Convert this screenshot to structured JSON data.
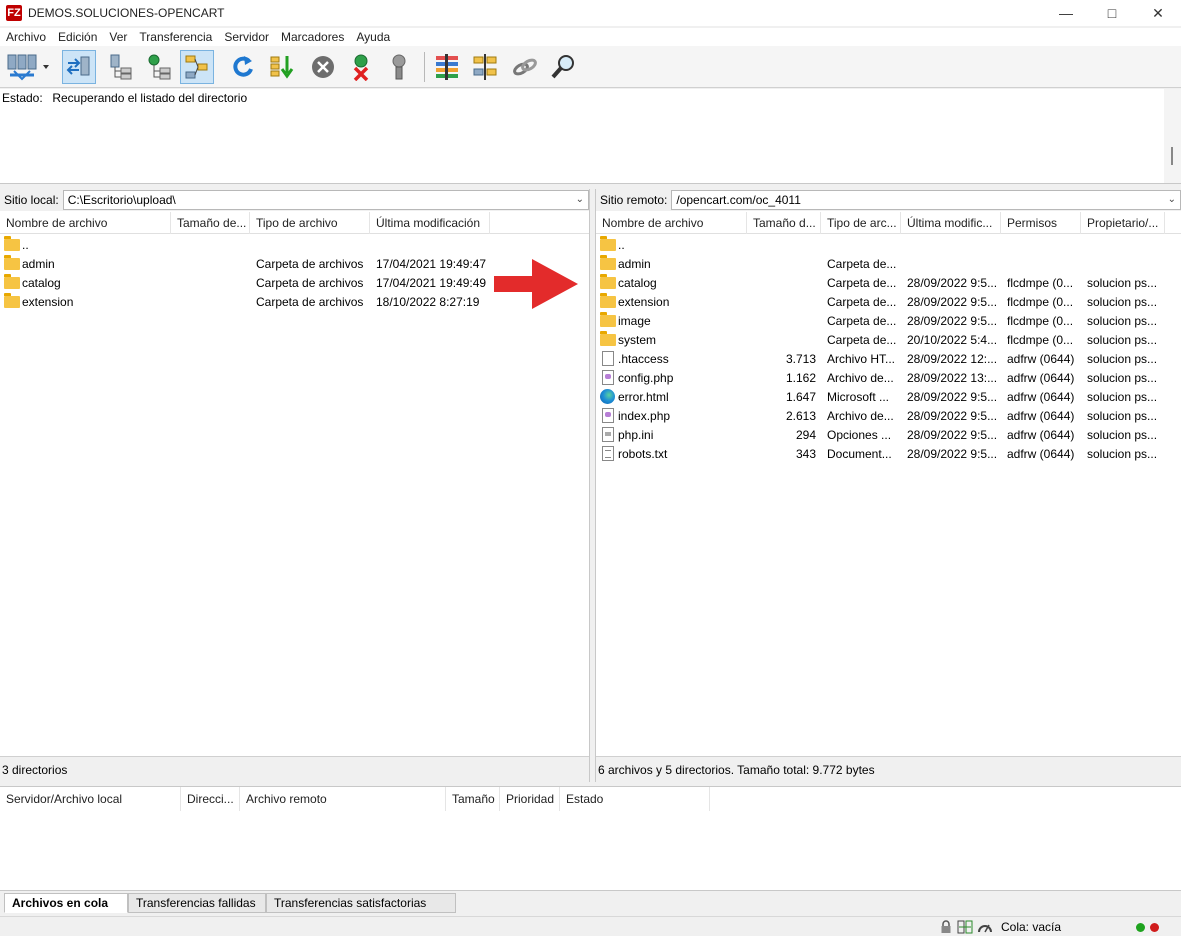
{
  "window": {
    "title": "DEMOS.SOLUCIONES-OPENCART",
    "app_icon": "FZ",
    "controls": [
      "minimize-icon",
      "maximize-icon",
      "close-icon"
    ]
  },
  "menu": [
    "Archivo",
    "Edición",
    "Ver",
    "Transferencia",
    "Servidor",
    "Marcadores",
    "Ayuda"
  ],
  "toolbar": {
    "buttons": [
      "site-manager-icon",
      "toggle-message-log-icon",
      "toggle-local-tree-icon",
      "toggle-remote-tree-icon",
      "toggle-queue-icon",
      "refresh-icon",
      "process-queue-icon",
      "cancel-icon",
      "disconnect-icon",
      "reconnect-icon",
      "directory-comparison-icon",
      "filter-icon",
      "sync-browsing-icon",
      "search-icon"
    ]
  },
  "message_log": {
    "label": "Estado:",
    "text": "Recuperando el listado del directorio"
  },
  "local": {
    "site_label": "Sitio local:",
    "path": "C:\\Escritorio\\upload\\",
    "columns": [
      "Nombre de archivo",
      "Tamaño de...",
      "Tipo de archivo",
      "Última modificación"
    ],
    "rows": [
      {
        "name": "..",
        "size": "",
        "type": "",
        "modified": "",
        "icon": "folder"
      },
      {
        "name": "admin",
        "size": "",
        "type": "Carpeta de archivos",
        "modified": "17/04/2021 19:49:47",
        "icon": "folder"
      },
      {
        "name": "catalog",
        "size": "",
        "type": "Carpeta de archivos",
        "modified": "17/04/2021 19:49:49",
        "icon": "folder"
      },
      {
        "name": "extension",
        "size": "",
        "type": "Carpeta de archivos",
        "modified": "18/10/2022 8:27:19",
        "icon": "folder"
      }
    ],
    "status": "3 directorios"
  },
  "remote": {
    "site_label": "Sitio remoto:",
    "path": "/opencart.com/oc_4011",
    "columns": [
      "Nombre de archivo",
      "Tamaño d...",
      "Tipo de arc...",
      "Última modific...",
      "Permisos",
      "Propietario/..."
    ],
    "rows": [
      {
        "name": "..",
        "size": "",
        "type": "",
        "modified": "",
        "perms": "",
        "owner": "",
        "icon": "folder"
      },
      {
        "name": "admin",
        "size": "",
        "type": "Carpeta de...",
        "modified": "",
        "perms": "",
        "owner": "",
        "icon": "folder"
      },
      {
        "name": "catalog",
        "size": "",
        "type": "Carpeta de...",
        "modified": "28/09/2022 9:5...",
        "perms": "flcdmpe (0...",
        "owner": "solucion ps...",
        "icon": "folder"
      },
      {
        "name": "extension",
        "size": "",
        "type": "Carpeta de...",
        "modified": "28/09/2022 9:5...",
        "perms": "flcdmpe (0...",
        "owner": "solucion ps...",
        "icon": "folder"
      },
      {
        "name": "image",
        "size": "",
        "type": "Carpeta de...",
        "modified": "28/09/2022 9:5...",
        "perms": "flcdmpe (0...",
        "owner": "solucion ps...",
        "icon": "folder"
      },
      {
        "name": "system",
        "size": "",
        "type": "Carpeta de...",
        "modified": "20/10/2022 5:4...",
        "perms": "flcdmpe (0...",
        "owner": "solucion ps...",
        "icon": "folder"
      },
      {
        "name": ".htaccess",
        "size": "3.713",
        "type": "Archivo HT...",
        "modified": "28/09/2022 12:...",
        "perms": "adfrw (0644)",
        "owner": "solucion ps...",
        "icon": "file"
      },
      {
        "name": "config.php",
        "size": "1.162",
        "type": "Archivo de...",
        "modified": "28/09/2022 13:...",
        "perms": "adfrw (0644)",
        "owner": "solucion ps...",
        "icon": "php"
      },
      {
        "name": "error.html",
        "size": "1.647",
        "type": "Microsoft ...",
        "modified": "28/09/2022 9:5...",
        "perms": "adfrw (0644)",
        "owner": "solucion ps...",
        "icon": "edge"
      },
      {
        "name": "index.php",
        "size": "2.613",
        "type": "Archivo de...",
        "modified": "28/09/2022 9:5...",
        "perms": "adfrw (0644)",
        "owner": "solucion ps...",
        "icon": "php"
      },
      {
        "name": "php.ini",
        "size": "294",
        "type": "Opciones ...",
        "modified": "28/09/2022 9:5...",
        "perms": "adfrw (0644)",
        "owner": "solucion ps...",
        "icon": "ini"
      },
      {
        "name": "robots.txt",
        "size": "343",
        "type": "Document...",
        "modified": "28/09/2022 9:5...",
        "perms": "adfrw (0644)",
        "owner": "solucion ps...",
        "icon": "txt"
      }
    ],
    "status": "6 archivos y 5 directorios. Tamaño total: 9.772 bytes"
  },
  "queue": {
    "columns": [
      "Servidor/Archivo local",
      "Direcci...",
      "Archivo remoto",
      "Tamaño",
      "Prioridad",
      "Estado"
    ]
  },
  "tabs": [
    "Archivos en cola",
    "Transferencias fallidas",
    "Transferencias satisfactorias"
  ],
  "statusbar": {
    "queue": "Cola: vacía",
    "icons": [
      "lock-icon",
      "binary-mode-icon",
      "speed-limit-icon"
    ],
    "led_colors": [
      "#1fa31f",
      "#d01c1c"
    ]
  },
  "colors": {
    "arrow": "#e32b2b",
    "folder": "#f6c443",
    "active_toolbar": "#cce4f7"
  }
}
